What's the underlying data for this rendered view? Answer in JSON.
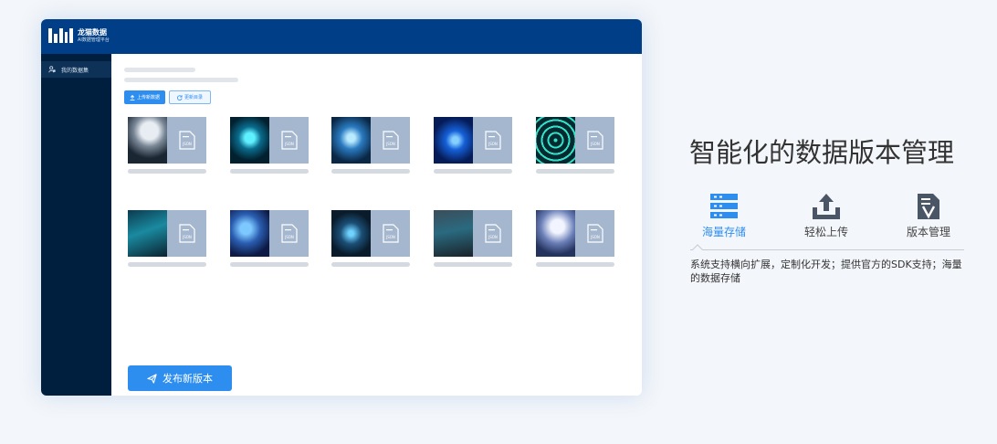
{
  "app": {
    "name": "龙猫数据",
    "subtitle": "AI数据管理平台"
  },
  "sidebar": {
    "items": [
      {
        "label": "我的数据集",
        "icon": "user-data-icon"
      }
    ]
  },
  "toolbar": {
    "upload_label": "上传新数据",
    "update_label": "更新目录"
  },
  "grid": {
    "file_label": "JSON",
    "cards": [
      {
        "theme": "robot",
        "icon": "file-icon"
      },
      {
        "theme": "brain-hand",
        "icon": "file-icon"
      },
      {
        "theme": "touch-screen",
        "icon": "file-icon"
      },
      {
        "theme": "blue-swirl",
        "icon": "file-icon"
      },
      {
        "theme": "circuit-rings",
        "icon": "file-icon"
      },
      {
        "theme": "digital-hand",
        "icon": "file-icon"
      },
      {
        "theme": "neon-head",
        "icon": "file-icon"
      },
      {
        "theme": "network-brain",
        "icon": "file-icon"
      },
      {
        "theme": "city-robot",
        "icon": "file-icon"
      },
      {
        "theme": "vr-woman",
        "icon": "file-icon"
      }
    ]
  },
  "publish": {
    "label": "发布新版本",
    "icon": "send-icon"
  },
  "feature": {
    "title": "智能化的数据版本管理",
    "tabs": [
      {
        "label": "海量存储",
        "icon": "storage-icon",
        "active": true
      },
      {
        "label": "轻松上传",
        "icon": "upload-icon",
        "active": false
      },
      {
        "label": "版本管理",
        "icon": "version-doc-icon",
        "active": false
      }
    ],
    "description": "系统支持横向扩展，定制化开发；提供官方的SDK支持；海量的数据存储"
  },
  "colors": {
    "topbar": "#003f87",
    "sidebar": "#001f3f",
    "accent": "#2e8ef0",
    "thumb_bg": "#a5b7cf"
  }
}
